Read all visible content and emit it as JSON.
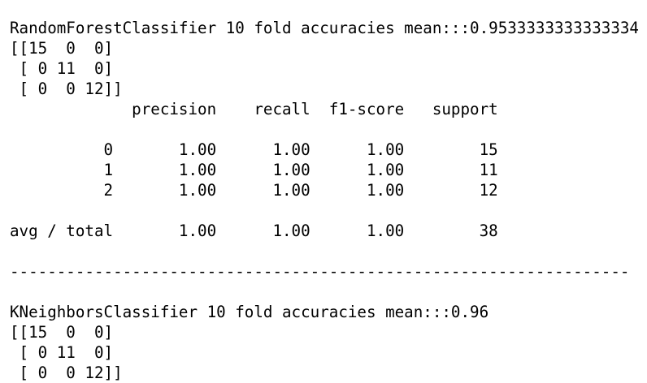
{
  "output": {
    "lines": [
      "RandomForestClassifier 10 fold accuracies mean:::0.9533333333333334",
      "[[15  0  0]",
      " [ 0 11  0]",
      " [ 0  0 12]]",
      "             precision    recall  f1-score   support",
      "",
      "          0       1.00      1.00      1.00        15",
      "          1       1.00      1.00      1.00        11",
      "          2       1.00      1.00      1.00        12",
      "",
      "avg / total       1.00      1.00      1.00        38",
      "",
      "------------------------------------------------------------------",
      "",
      "KNeighborsClassifier 10 fold accuracies mean:::0.96",
      "[[15  0  0]",
      " [ 0 11  0]",
      " [ 0  0 12]]"
    ]
  }
}
